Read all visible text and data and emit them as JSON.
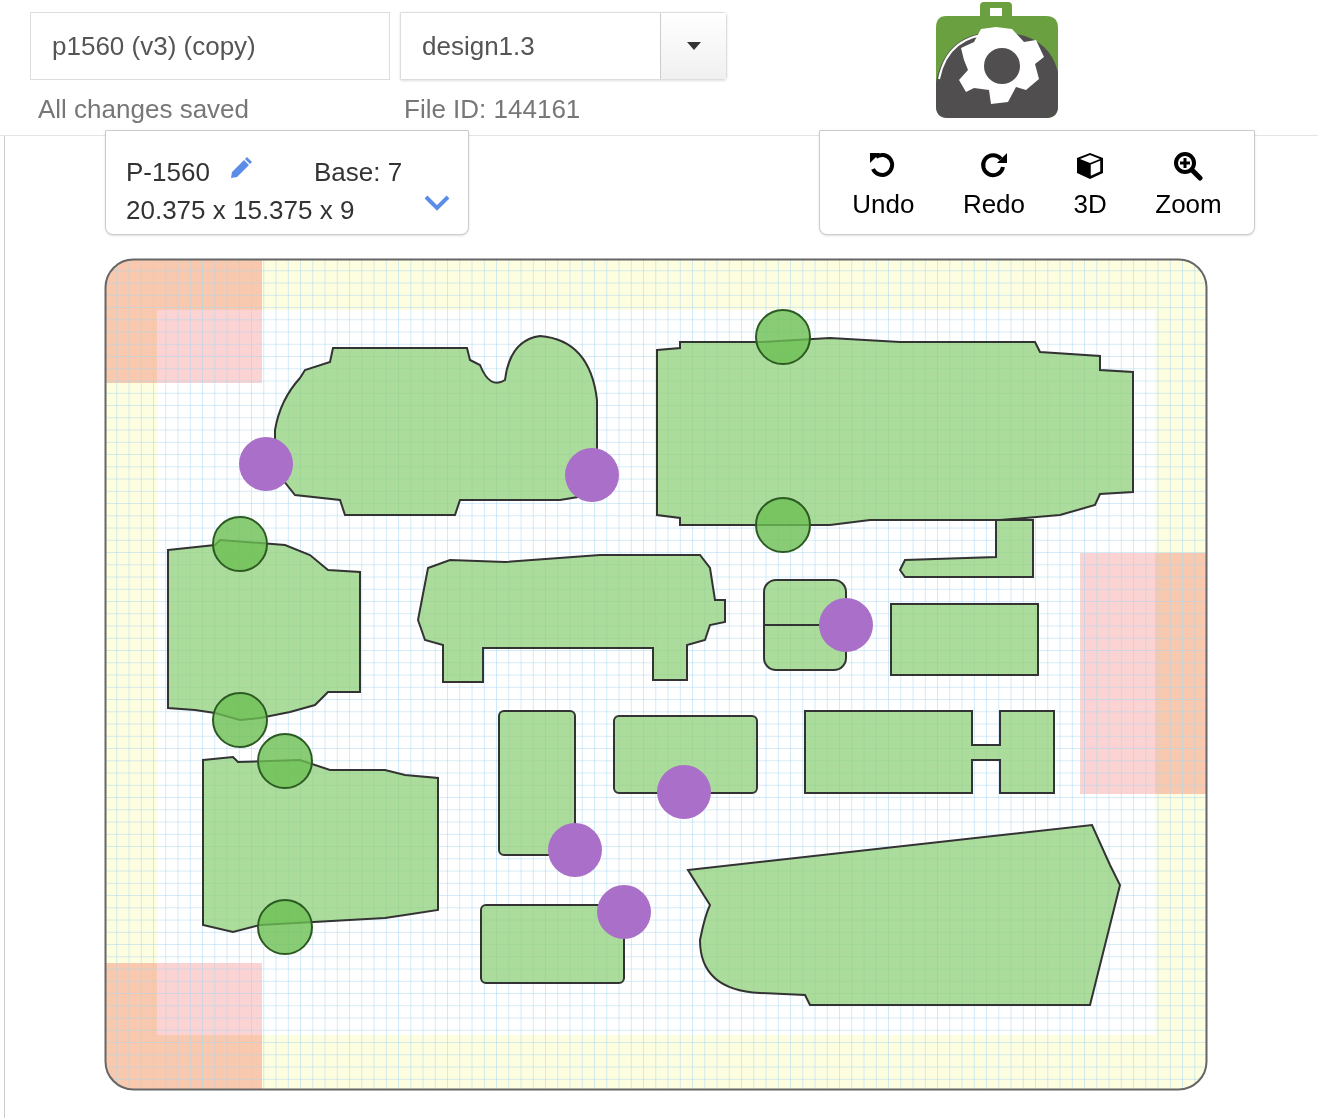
{
  "header": {
    "project_name": {
      "value": "p1560 (v3) (copy)"
    },
    "design_select": {
      "value": "design1.3"
    },
    "save_status": "All changes saved",
    "file_id": "File ID: 144161"
  },
  "part_card": {
    "name": "P-1560",
    "base": "Base: 7",
    "dimensions": "20.375 x 15.375 x 9"
  },
  "toolbar": [
    {
      "kind": "undo",
      "label": "Undo"
    },
    {
      "kind": "redo",
      "label": "Redo"
    },
    {
      "kind": "cube",
      "label": "3D"
    },
    {
      "kind": "zoom",
      "label": "Zoom"
    }
  ]
}
